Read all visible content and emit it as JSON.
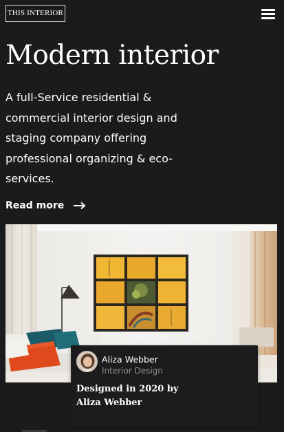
{
  "header": {
    "logo_text": "THIS INTERIOR",
    "menu_icon": "hamburger-menu-icon"
  },
  "hero": {
    "title": "Modern interior",
    "description": "A full-Service residential & commercial interior design and staging company offering professional organizing & eco-services.",
    "read_more_label": "Read more",
    "read_more_icon": "arrow-right-icon"
  },
  "card": {
    "author_name": "Aliza Webber",
    "author_role": "Interior Design",
    "title": "Designed in 2020 by Aliza Webber"
  },
  "colors": {
    "background": "#1b1b1d",
    "text": "#ffffff",
    "muted_text": "#8d8d92",
    "card_background": "#1c1c1e"
  }
}
